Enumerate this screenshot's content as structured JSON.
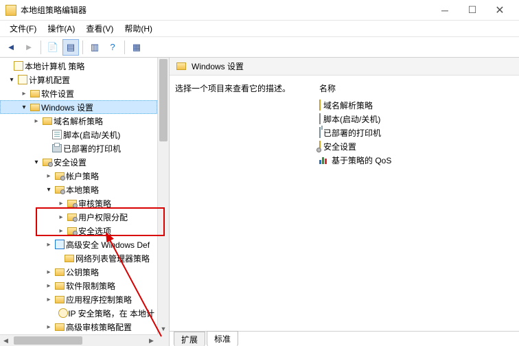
{
  "window": {
    "title": "本地组策略编辑器"
  },
  "menu": {
    "file": "文件(F)",
    "action": "操作(A)",
    "view": "查看(V)",
    "help": "帮助(H)"
  },
  "tree": {
    "root": "本地计算机 策略",
    "computer_config": "计算机配置",
    "software_settings": "软件设置",
    "windows_settings": "Windows 设置",
    "dns_policy": "域名解析策略",
    "scripts": "脚本(启动/关机)",
    "printers": "已部署的打印机",
    "security_settings": "安全设置",
    "account_policies": "帐户策略",
    "local_policies": "本地策略",
    "audit_policy": "审核策略",
    "user_rights": "用户权限分配",
    "security_options": "安全选项",
    "windows_defender_fw": "高级安全 Windows Def",
    "network_list": "网络列表管理器策略",
    "public_key": "公钥策略",
    "software_restriction": "软件限制策略",
    "app_control": "应用程序控制策略",
    "ipsec": "IP 安全策略，在 本地计",
    "advanced_audit": "高级审核策略配置"
  },
  "content": {
    "header": "Windows 设置",
    "description": "选择一个项目来查看它的描述。",
    "name_label": "名称",
    "items": {
      "dns": "域名解析策略",
      "scripts": "脚本(启动/关机)",
      "printers": "已部署的打印机",
      "security": "安全设置",
      "qos": "基于策略的 QoS"
    }
  },
  "tabs": {
    "extended": "扩展",
    "standard": "标准"
  }
}
